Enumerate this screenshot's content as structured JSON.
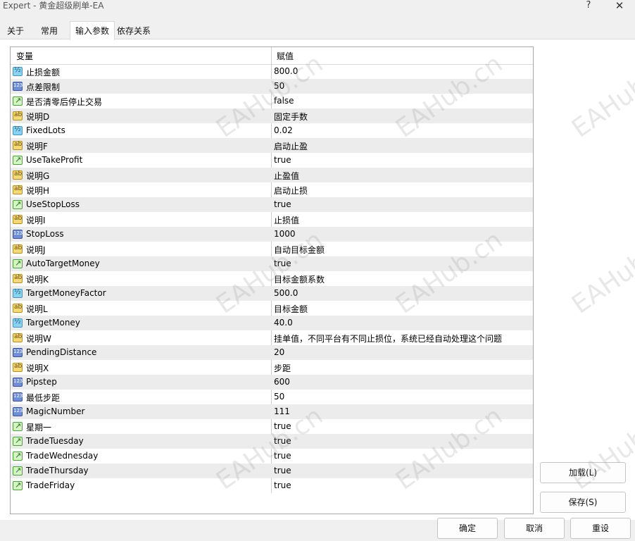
{
  "window": {
    "title": "Expert - 黄金超级刷单-EA",
    "help_label": "?",
    "close_label": "✕"
  },
  "tabs": [
    {
      "label": "关于"
    },
    {
      "label": "常用"
    },
    {
      "label": "输入参数"
    },
    {
      "label": "依存关系"
    }
  ],
  "table": {
    "headers": {
      "variable": "变量",
      "value": "赋值"
    },
    "rows": [
      {
        "type": "double",
        "name": "止损金额",
        "value": "800.0"
      },
      {
        "type": "int",
        "name": "点差限制",
        "value": "50"
      },
      {
        "type": "bool",
        "name": "是否清零后停止交易",
        "value": "false"
      },
      {
        "type": "string",
        "name": "说明D",
        "value": "固定手数"
      },
      {
        "type": "double",
        "name": "FixedLots",
        "value": "0.02"
      },
      {
        "type": "string",
        "name": "说明F",
        "value": "启动止盈"
      },
      {
        "type": "bool",
        "name": "UseTakeProfit",
        "value": "true"
      },
      {
        "type": "string",
        "name": "说明G",
        "value": "止盈值"
      },
      {
        "type": "string",
        "name": "说明H",
        "value": "启动止损"
      },
      {
        "type": "bool",
        "name": "UseStopLoss",
        "value": "true"
      },
      {
        "type": "string",
        "name": "说明I",
        "value": "止损值"
      },
      {
        "type": "int",
        "name": "StopLoss",
        "value": "1000"
      },
      {
        "type": "string",
        "name": "说明J",
        "value": "自动目标金额"
      },
      {
        "type": "bool",
        "name": "AutoTargetMoney",
        "value": "true"
      },
      {
        "type": "string",
        "name": "说明K",
        "value": "目标金额系数"
      },
      {
        "type": "double",
        "name": "TargetMoneyFactor",
        "value": "500.0"
      },
      {
        "type": "string",
        "name": "说明L",
        "value": "目标金额"
      },
      {
        "type": "double",
        "name": "TargetMoney",
        "value": "40.0"
      },
      {
        "type": "string",
        "name": "说明W",
        "value": "挂单值，不同平台有不同止损位，系统已经自动处理这个问题"
      },
      {
        "type": "int",
        "name": "PendingDistance",
        "value": "20"
      },
      {
        "type": "string",
        "name": "说明X",
        "value": "步距"
      },
      {
        "type": "int",
        "name": "Pipstep",
        "value": "600"
      },
      {
        "type": "int",
        "name": "最低步距",
        "value": "50"
      },
      {
        "type": "int",
        "name": "MagicNumber",
        "value": "111"
      },
      {
        "type": "bool",
        "name": "星期一",
        "value": "true"
      },
      {
        "type": "bool",
        "name": "TradeTuesday",
        "value": "true"
      },
      {
        "type": "bool",
        "name": "TradeWednesday",
        "value": "true"
      },
      {
        "type": "bool",
        "name": "TradeThursday",
        "value": "true"
      },
      {
        "type": "bool",
        "name": "TradeFriday",
        "value": "true"
      }
    ]
  },
  "side_buttons": {
    "load": "加载(L)",
    "save": "保存(S)"
  },
  "footer_buttons": {
    "ok": "确定",
    "cancel": "取消",
    "reset": "重设"
  },
  "watermark": "EAHub.cn"
}
